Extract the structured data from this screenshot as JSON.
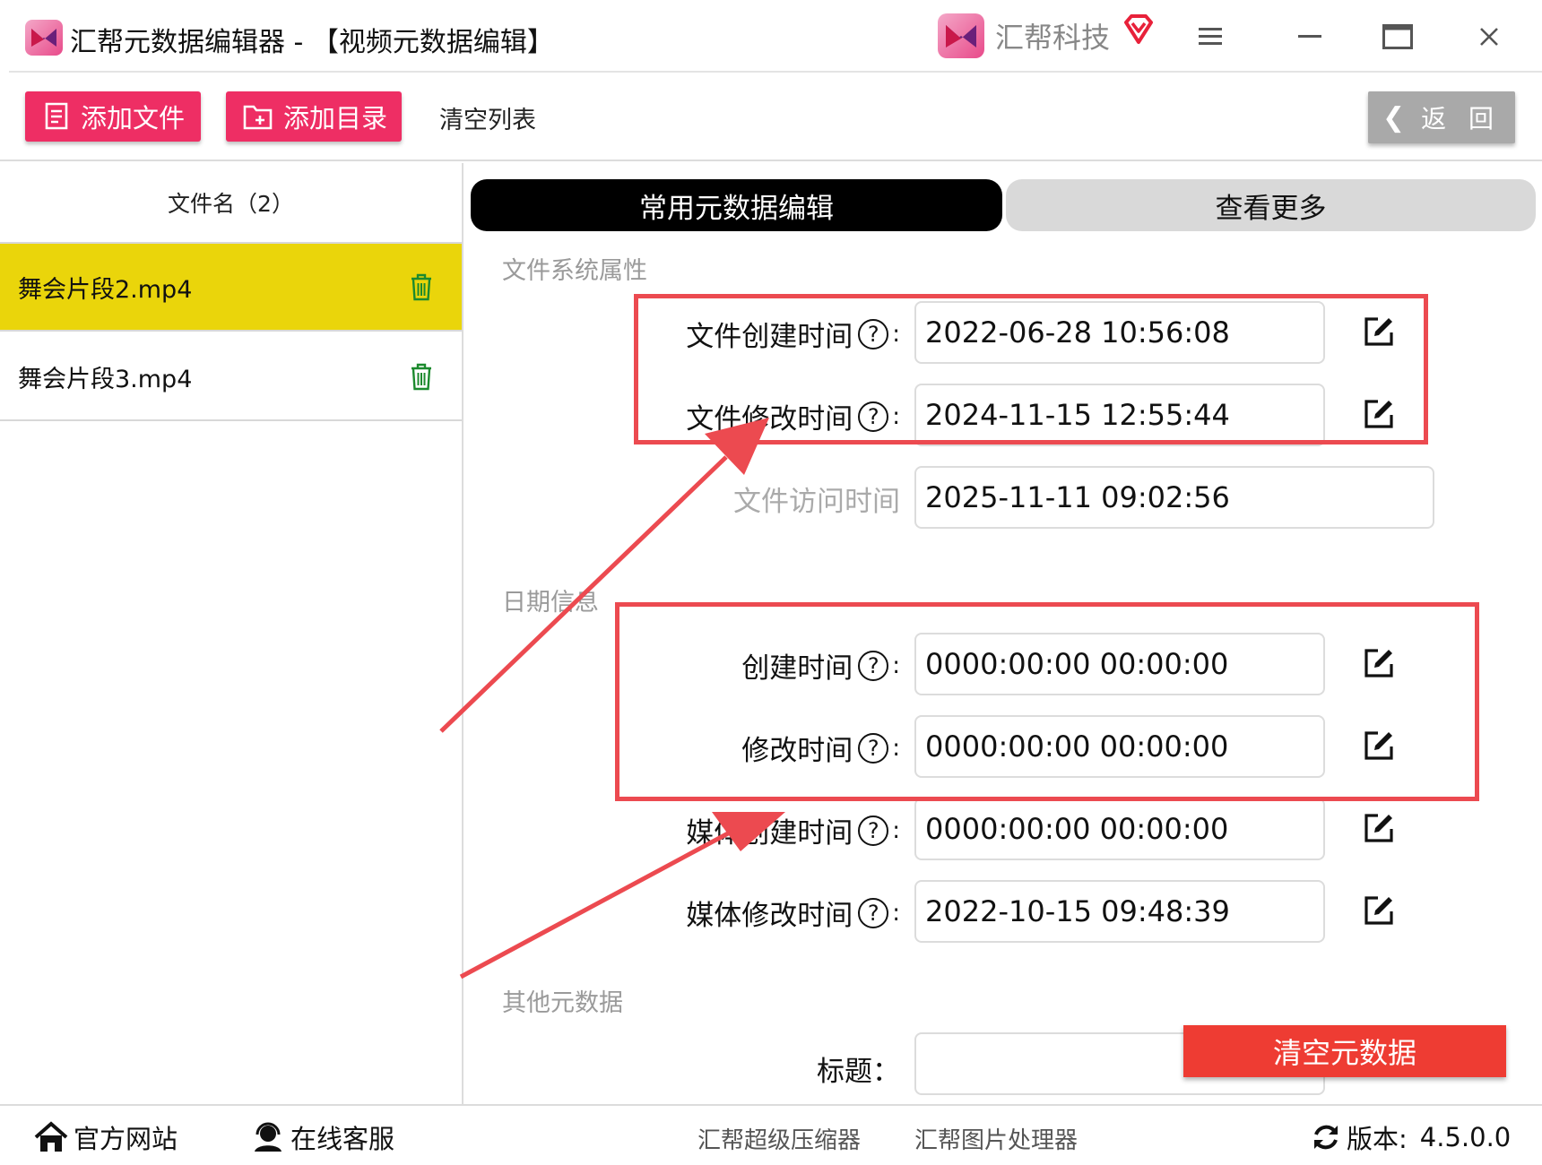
{
  "window": {
    "title": "汇帮元数据编辑器 - 【视频元数据编辑】",
    "brand_name": "汇帮科技"
  },
  "toolbar": {
    "add_file": "添加文件",
    "add_dir": "添加目录",
    "clear_list": "清空列表",
    "back": "返 回"
  },
  "file_list": {
    "header": "文件名（2）",
    "items": [
      {
        "name": "舞会片段2.mp4",
        "selected": true
      },
      {
        "name": "舞会片段3.mp4",
        "selected": false
      }
    ]
  },
  "tabs": {
    "common": "常用元数据编辑",
    "more": "查看更多"
  },
  "sections": {
    "filesystem": "文件系统属性",
    "dates": "日期信息",
    "other": "其他元数据"
  },
  "fields": {
    "file_created": {
      "label": "文件创建时间",
      "value": "2022-06-28 10:56:08"
    },
    "file_modified": {
      "label": "文件修改时间",
      "value": "2024-11-15 12:55:44"
    },
    "file_accessed": {
      "label": "文件访问时间",
      "value": "2025-11-11 09:02:56"
    },
    "created": {
      "label": "创建时间",
      "value": "0000:00:00 00:00:00"
    },
    "modified": {
      "label": "修改时间",
      "value": "0000:00:00 00:00:00"
    },
    "media_created": {
      "label": "媒体创建时间",
      "value": "0000:00:00 00:00:00"
    },
    "media_modified": {
      "label": "媒体修改时间",
      "value": "2022-10-15 09:48:39"
    },
    "title": {
      "label": "标题：",
      "value": ""
    }
  },
  "actions": {
    "clear_metadata": "清空元数据"
  },
  "footer": {
    "website": "官方网站",
    "support": "在线客服",
    "compressor": "汇帮超级压缩器",
    "image_tool": "汇帮图片处理器",
    "version_label": "版本:",
    "version": "4.5.0.0"
  },
  "colors": {
    "accent_pink": "#ee2e64",
    "selected_row": "#ead50b",
    "annotation_red": "#ec4a50",
    "clear_button": "#ee3c33"
  }
}
